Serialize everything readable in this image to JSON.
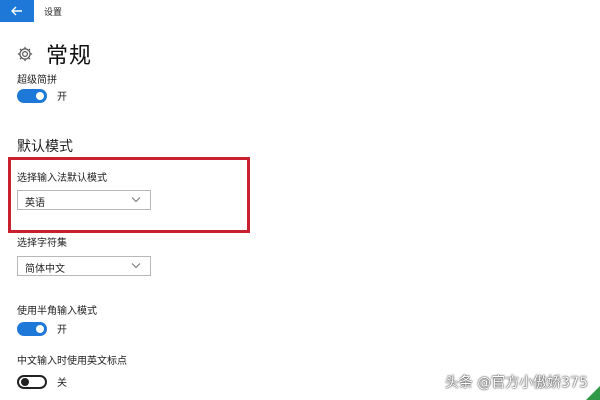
{
  "window": {
    "title": "设置",
    "back_icon": "back-arrow-icon",
    "accent_color": "#1e78d7"
  },
  "page": {
    "icon": "gear-icon",
    "title": "常规"
  },
  "fuzzy_pinyin": {
    "label": "超级简拼",
    "state_text": "开",
    "on": true
  },
  "default_mode": {
    "section_title": "默认模式",
    "input_mode": {
      "label": "选择输入法默认模式",
      "selected": "英语"
    },
    "charset": {
      "label": "选择字符集",
      "selected": "简体中文"
    }
  },
  "half_width": {
    "label": "使用半角输入模式",
    "state_text": "开",
    "on": true
  },
  "english_punct": {
    "label": "中文输入时使用英文标点",
    "state_text": "关",
    "on": false
  },
  "highlight_color": "#c8202e",
  "watermark": "头条 @官方小傲娇375"
}
